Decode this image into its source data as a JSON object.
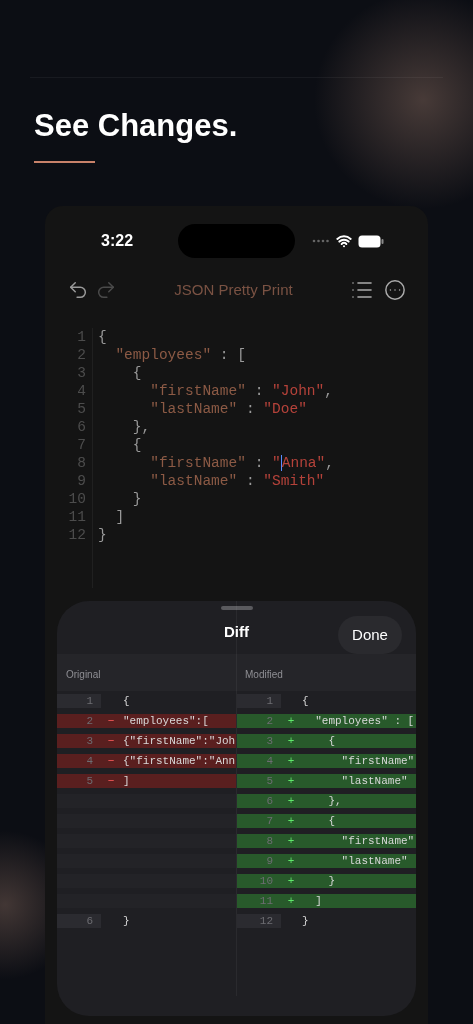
{
  "heading": "See Changes.",
  "status_bar": {
    "time": "3:22"
  },
  "toolbar": {
    "title": "JSON Pretty Print"
  },
  "editor": {
    "lines": [
      {
        "number": "1",
        "segments": [
          {
            "kind": "punct",
            "text": "{"
          }
        ]
      },
      {
        "number": "2",
        "segments": [
          {
            "kind": "key",
            "text": "  \"employees\""
          },
          {
            "kind": "punct",
            "text": " : ["
          }
        ]
      },
      {
        "number": "3",
        "segments": [
          {
            "kind": "punct",
            "text": "    {"
          }
        ]
      },
      {
        "number": "4",
        "segments": [
          {
            "kind": "key",
            "text": "      \"firstName\""
          },
          {
            "kind": "punct",
            "text": " : "
          },
          {
            "kind": "string",
            "text": "\"John\""
          },
          {
            "kind": "punct",
            "text": ","
          }
        ]
      },
      {
        "number": "5",
        "segments": [
          {
            "kind": "key",
            "text": "      \"lastName\""
          },
          {
            "kind": "punct",
            "text": " : "
          },
          {
            "kind": "string",
            "text": "\"Doe\""
          }
        ]
      },
      {
        "number": "6",
        "segments": [
          {
            "kind": "punct",
            "text": "    },"
          }
        ]
      },
      {
        "number": "7",
        "segments": [
          {
            "kind": "punct",
            "text": "    {"
          }
        ]
      },
      {
        "number": "8",
        "segments": [
          {
            "kind": "key",
            "text": "      \"firstName\""
          },
          {
            "kind": "punct",
            "text": " : "
          },
          {
            "kind": "string",
            "text": "\""
          },
          {
            "kind": "string",
            "text": "Anna\"",
            "cursor": true
          },
          {
            "kind": "punct",
            "text": ","
          }
        ]
      },
      {
        "number": "9",
        "segments": [
          {
            "kind": "key",
            "text": "      \"lastName\""
          },
          {
            "kind": "punct",
            "text": " : "
          },
          {
            "kind": "string",
            "text": "\"Smith\""
          }
        ]
      },
      {
        "number": "10",
        "segments": [
          {
            "kind": "punct",
            "text": "    }"
          }
        ]
      },
      {
        "number": "11",
        "segments": [
          {
            "kind": "punct",
            "text": "  ]"
          }
        ]
      },
      {
        "number": "12",
        "segments": [
          {
            "kind": "punct",
            "text": "}"
          }
        ]
      }
    ]
  },
  "diff": {
    "title": "Diff",
    "done_button": "Done",
    "columns": [
      "Original",
      "Modified"
    ],
    "rows": [
      {
        "left": {
          "kind": "same",
          "number": "1",
          "text": "{"
        },
        "right": {
          "kind": "same",
          "number": "1",
          "text": "{"
        }
      },
      {
        "left": {
          "kind": "removed",
          "number": "2",
          "marker": "−",
          "text": "\"employees\":["
        },
        "right": {
          "kind": "added",
          "number": "2",
          "marker": "+",
          "text": "  \"employees\" : ["
        }
      },
      {
        "left": {
          "kind": "removed",
          "number": "3",
          "marker": "−",
          "text": "{\"firstName\":\"Joh"
        },
        "right": {
          "kind": "added",
          "number": "3",
          "marker": "+",
          "text": "    {"
        }
      },
      {
        "left": {
          "kind": "removed",
          "number": "4",
          "marker": "−",
          "text": "{\"firstName\":\"Ann"
        },
        "right": {
          "kind": "added",
          "number": "4",
          "marker": "+",
          "text": "      \"firstName\""
        }
      },
      {
        "left": {
          "kind": "removed",
          "number": "5",
          "marker": "−",
          "text": "]"
        },
        "right": {
          "kind": "added",
          "number": "5",
          "marker": "+",
          "text": "      \"lastName\""
        }
      },
      {
        "left": {
          "kind": "empty"
        },
        "right": {
          "kind": "added",
          "number": "6",
          "marker": "+",
          "text": "    },"
        }
      },
      {
        "left": {
          "kind": "empty"
        },
        "right": {
          "kind": "added",
          "number": "7",
          "marker": "+",
          "text": "    {"
        }
      },
      {
        "left": {
          "kind": "empty"
        },
        "right": {
          "kind": "added",
          "number": "8",
          "marker": "+",
          "text": "      \"firstName\""
        }
      },
      {
        "left": {
          "kind": "empty"
        },
        "right": {
          "kind": "added",
          "number": "9",
          "marker": "+",
          "text": "      \"lastName\""
        }
      },
      {
        "left": {
          "kind": "empty"
        },
        "right": {
          "kind": "added",
          "number": "10",
          "marker": "+",
          "text": "    }"
        }
      },
      {
        "left": {
          "kind": "empty"
        },
        "right": {
          "kind": "added",
          "number": "11",
          "marker": "+",
          "text": "  ]"
        }
      },
      {
        "left": {
          "kind": "same",
          "number": "6",
          "text": "}"
        },
        "right": {
          "kind": "same",
          "number": "12",
          "text": "}"
        }
      }
    ]
  }
}
